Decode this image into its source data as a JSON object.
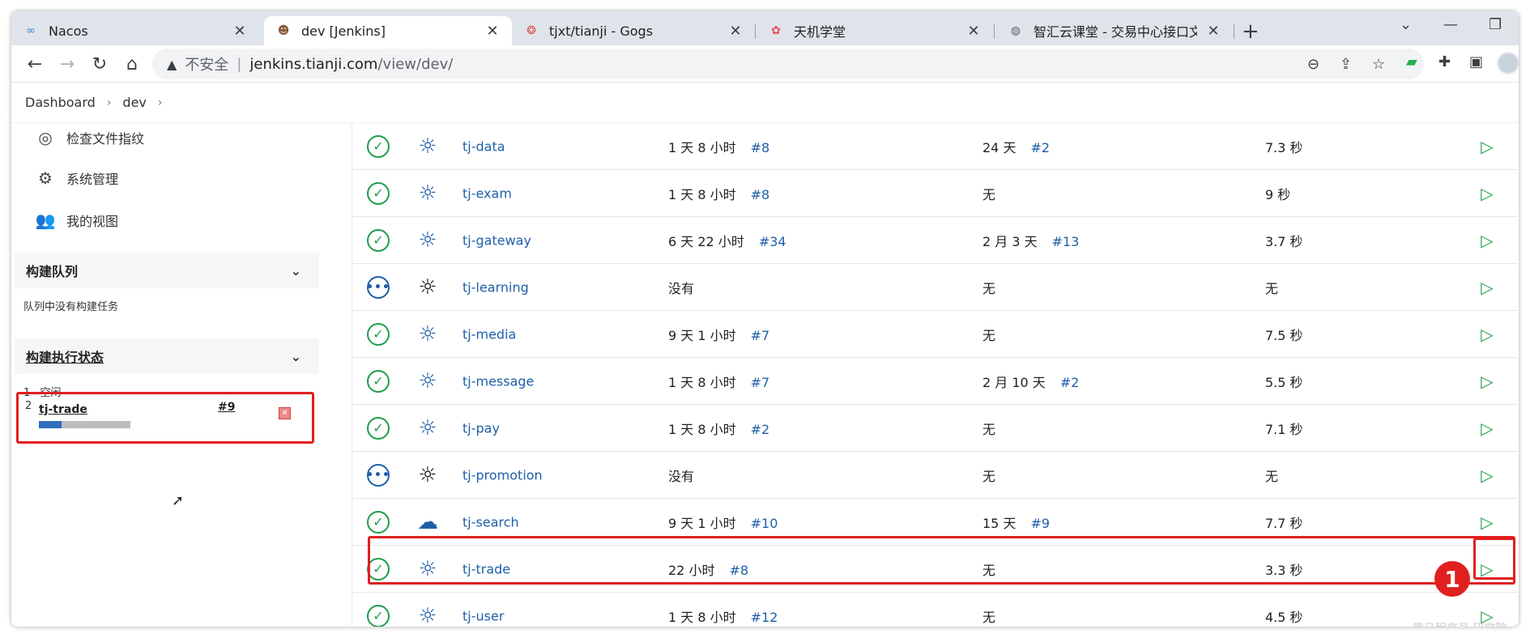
{
  "browser": {
    "tabs": [
      {
        "title": "Nacos",
        "icon": "infinity-icon",
        "active": false
      },
      {
        "title": "dev [Jenkins]",
        "icon": "jenkins-icon",
        "active": true
      },
      {
        "title": "tjxt/tianji - Gogs",
        "icon": "gogs-icon",
        "active": false
      },
      {
        "title": "天机学堂",
        "icon": "flower-icon",
        "active": false
      },
      {
        "title": "智汇云课堂 - 交易中心接口文档",
        "icon": "globe-icon",
        "active": false
      }
    ],
    "new_tab": "+",
    "address": {
      "security_label": "不安全",
      "host": "jenkins.tianji.com",
      "path": "/view/dev/"
    }
  },
  "breadcrumb": [
    "Dashboard",
    "dev"
  ],
  "sidebar": {
    "links": [
      {
        "label": "检查文件指纹",
        "icon": "fingerprint-icon"
      },
      {
        "label": "系统管理",
        "icon": "gear-icon"
      },
      {
        "label": "我的视图",
        "icon": "people-icon"
      }
    ],
    "build_queue": {
      "title": "构建队列",
      "empty_text": "队列中没有构建任务"
    },
    "executor_status": {
      "title": "构建执行状态",
      "executors": [
        {
          "number": "1",
          "state": "空闲"
        },
        {
          "number": "2",
          "job": "tj-trade",
          "build": "#9",
          "progress": 0.25
        }
      ]
    }
  },
  "jobs": [
    {
      "name": "tj-data",
      "status": "success",
      "weather": "sunny",
      "last_success": "1 天 8 小时",
      "last_success_build": "#8",
      "last_failure": "24 天",
      "last_failure_build": "#2",
      "duration": "7.3 秒"
    },
    {
      "name": "tj-exam",
      "status": "success",
      "weather": "sunny",
      "last_success": "1 天 8 小时",
      "last_success_build": "#8",
      "last_failure": "无",
      "last_failure_build": "",
      "duration": "9 秒"
    },
    {
      "name": "tj-gateway",
      "status": "success",
      "weather": "sunny",
      "last_success": "6 天 22 小时",
      "last_success_build": "#34",
      "last_failure": "2 月 3 天",
      "last_failure_build": "#13",
      "duration": "3.7 秒"
    },
    {
      "name": "tj-learning",
      "status": "notbuilt",
      "weather": "sunny-dark",
      "last_success": "没有",
      "last_success_build": "",
      "last_failure": "无",
      "last_failure_build": "",
      "duration": "无"
    },
    {
      "name": "tj-media",
      "status": "success",
      "weather": "sunny",
      "last_success": "9 天 1 小时",
      "last_success_build": "#7",
      "last_failure": "无",
      "last_failure_build": "",
      "duration": "7.5 秒"
    },
    {
      "name": "tj-message",
      "status": "success",
      "weather": "sunny",
      "last_success": "1 天 8 小时",
      "last_success_build": "#7",
      "last_failure": "2 月 10 天",
      "last_failure_build": "#2",
      "duration": "5.5 秒"
    },
    {
      "name": "tj-pay",
      "status": "success",
      "weather": "sunny",
      "last_success": "1 天 8 小时",
      "last_success_build": "#2",
      "last_failure": "无",
      "last_failure_build": "",
      "duration": "7.1 秒"
    },
    {
      "name": "tj-promotion",
      "status": "notbuilt",
      "weather": "sunny-dark",
      "last_success": "没有",
      "last_success_build": "",
      "last_failure": "无",
      "last_failure_build": "",
      "duration": "无"
    },
    {
      "name": "tj-search",
      "status": "success",
      "weather": "cloudy",
      "last_success": "9 天 1 小时",
      "last_success_build": "#10",
      "last_failure": "15 天",
      "last_failure_build": "#9",
      "duration": "7.7 秒"
    },
    {
      "name": "tj-trade",
      "status": "success",
      "weather": "sunny",
      "last_success": "22 小时",
      "last_success_build": "#8",
      "last_failure": "无",
      "last_failure_build": "",
      "duration": "3.3 秒"
    },
    {
      "name": "tj-user",
      "status": "success",
      "weather": "sunny",
      "last_success": "1 天 8 小时",
      "last_success_build": "#12",
      "last_failure": "无",
      "last_failure_build": "",
      "duration": "4.5 秒"
    }
  ],
  "annotation": {
    "callout_number": "1"
  },
  "watermark": "黑马程序员·研究院",
  "colors": {
    "success": "#1e9e4a",
    "link": "#1f5fa8",
    "highlight": "#e02020"
  }
}
